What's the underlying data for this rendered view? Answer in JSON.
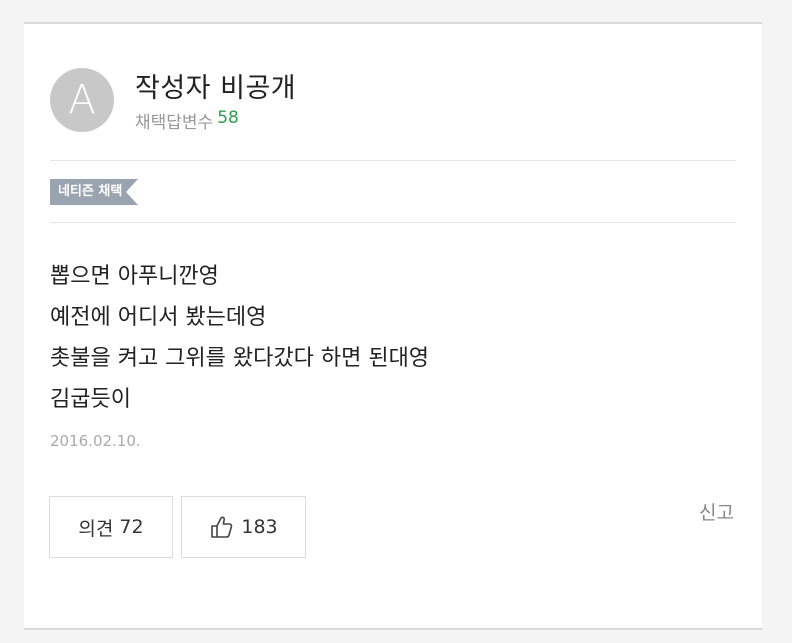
{
  "author": {
    "avatar_letter": "A",
    "name": "작성자 비공개",
    "answer_count_label": "채택답변수",
    "answer_count": "58"
  },
  "badge": {
    "label": "네티즌 채택"
  },
  "answer": {
    "lines": [
      "뽑으면 아푸니깐영",
      "예전에 어디서 봤는데영",
      "촛불을 켜고 그위를 왔다갔다 하면 된대영",
      "김굽듯이"
    ],
    "date": "2016.02.10."
  },
  "actions": {
    "comment_label": "의견",
    "comment_count": "72",
    "like_icon": "thumbs-up-icon",
    "like_count": "183",
    "report_label": "신고"
  },
  "colors": {
    "accent_green": "#2e9d4e",
    "badge_gray": "#9aa3b0",
    "avatar_gray": "#c8c8c8"
  }
}
